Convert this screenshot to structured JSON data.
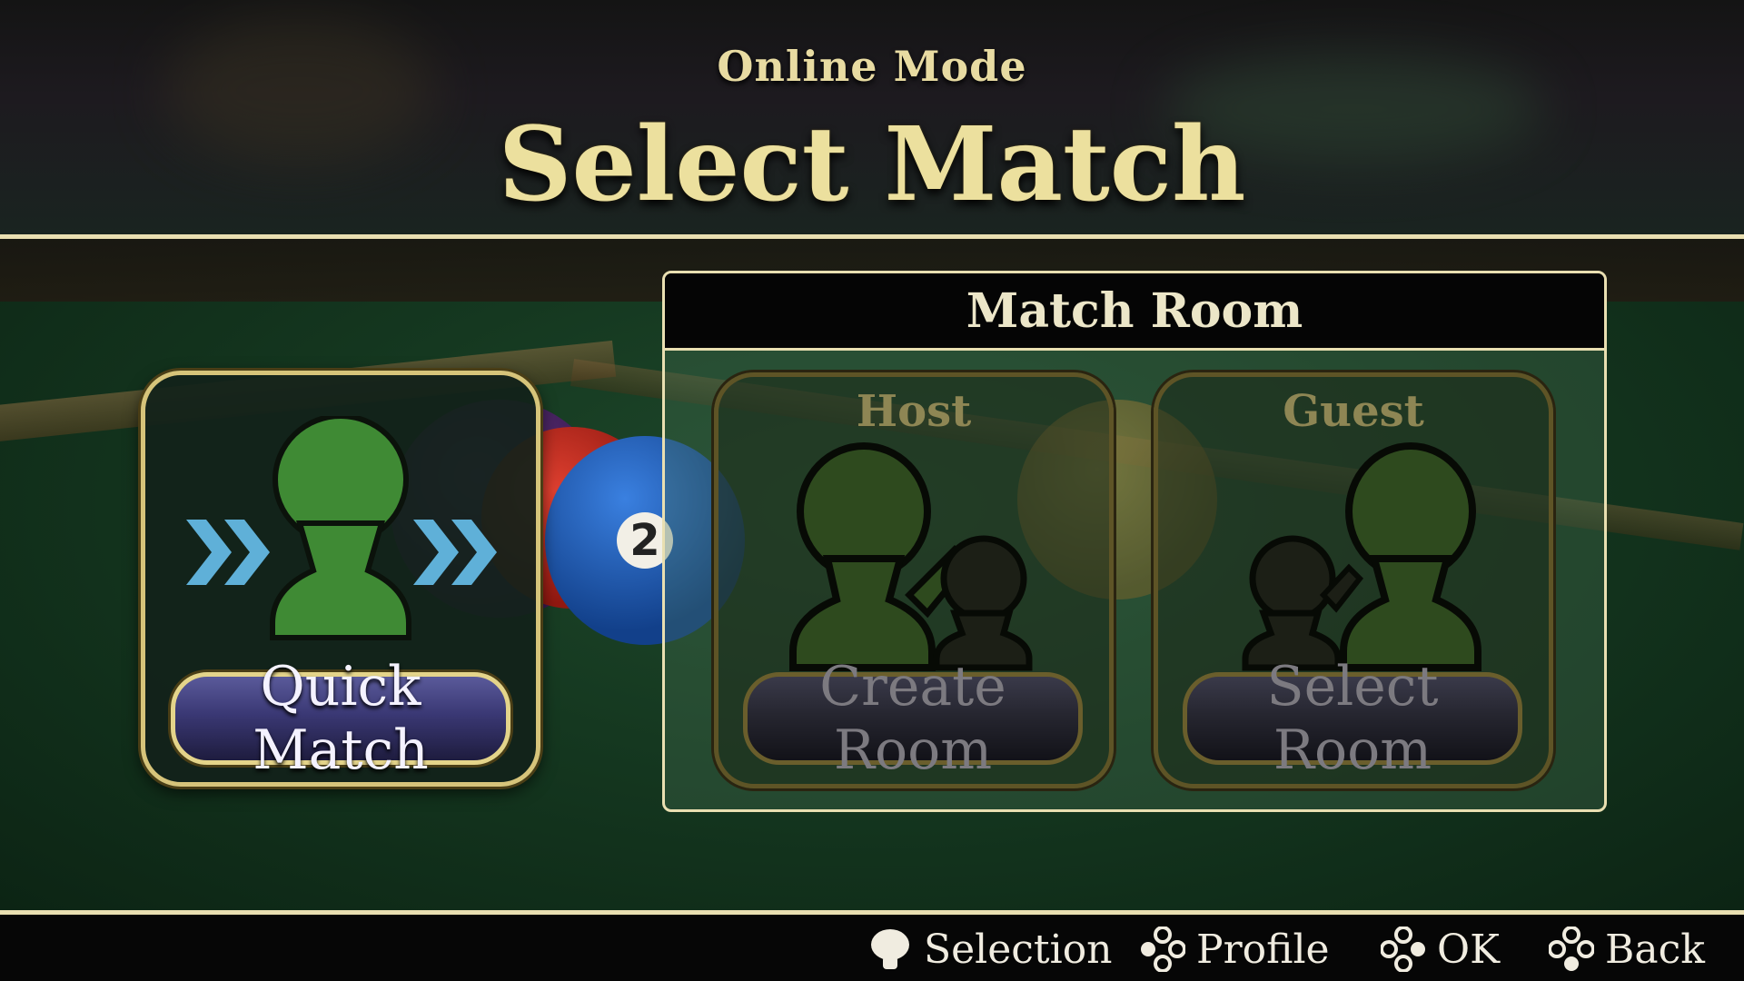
{
  "header": {
    "subtitle": "Online Mode",
    "title": "Select Match"
  },
  "quick_match": {
    "button_label": "Quick Match"
  },
  "match_room": {
    "title": "Match Room",
    "host": {
      "label": "Host",
      "button_label": "Create Room"
    },
    "guest": {
      "label": "Guest",
      "button_label": "Select Room"
    }
  },
  "footer": {
    "hints": [
      {
        "icon": "stick-icon",
        "label": "Selection"
      },
      {
        "icon": "buttons-icon",
        "label": "Profile"
      },
      {
        "icon": "buttons-icon",
        "label": "OK"
      },
      {
        "icon": "buttons-icon",
        "label": "Back"
      }
    ]
  },
  "background": {
    "ball_numbers": [
      "2"
    ]
  },
  "colors": {
    "accent_gold": "#e9dfb1",
    "person_green": "#3f8a34",
    "chevron_blue": "#5fb0d8",
    "button_purple": "#3a3874"
  }
}
